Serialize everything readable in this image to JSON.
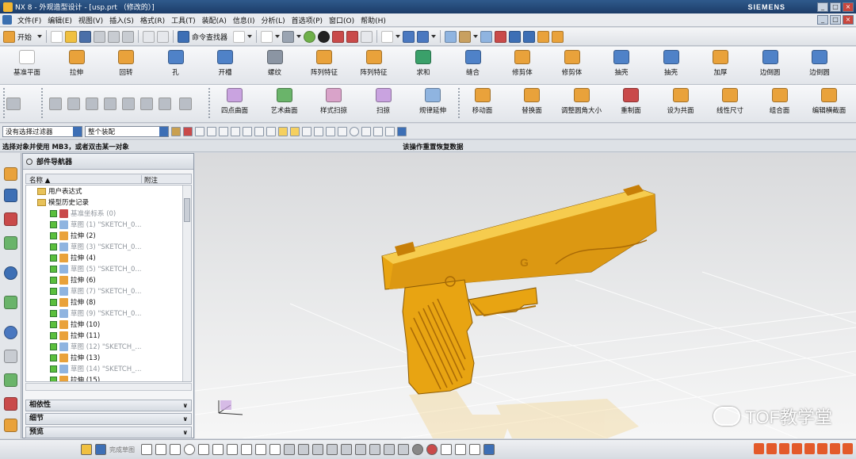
{
  "window": {
    "title": "NX 8 - 外观造型设计 - [usp.prt （修改的）]",
    "brand": "SIEMENS",
    "min": "_",
    "max": "□",
    "close": "×"
  },
  "menu": [
    "文件(F)",
    "编辑(E)",
    "视图(V)",
    "插入(S)",
    "格式(R)",
    "工具(T)",
    "装配(A)",
    "信息(I)",
    "分析(L)",
    "首选项(P)",
    "窗口(O)",
    "帮助(H)"
  ],
  "std_toolbar": {
    "start_label": "开始",
    "command_finder_label": "命令查找器"
  },
  "feature_toolbar_1": [
    {
      "label": "基准平面",
      "icon": "datum-plane-icon",
      "color": "#ffffff"
    },
    {
      "label": "拉伸",
      "icon": "extrude-icon",
      "color": "#e9a23b"
    },
    {
      "label": "回转",
      "icon": "revolve-icon",
      "color": "#e9a23b"
    },
    {
      "label": "孔",
      "icon": "hole-icon",
      "color": "#4f82c8"
    },
    {
      "label": "开槽",
      "icon": "groove-icon",
      "color": "#4f82c8"
    },
    {
      "label": "螺纹",
      "icon": "thread-icon",
      "color": "#8b95a3"
    },
    {
      "label": "阵列特征",
      "icon": "pattern-feature-icon",
      "color": "#e9a23b"
    },
    {
      "label": "阵列特征",
      "icon": "pattern-feature-icon",
      "color": "#e9a23b"
    },
    {
      "label": "求和",
      "icon": "unite-icon",
      "color": "#3aa06a"
    },
    {
      "label": "缝合",
      "icon": "sew-icon",
      "color": "#4f82c8"
    },
    {
      "label": "修剪体",
      "icon": "trim-body-icon",
      "color": "#e9a23b"
    },
    {
      "label": "修剪体",
      "icon": "trim-body-icon",
      "color": "#e9a23b"
    },
    {
      "label": "抽壳",
      "icon": "shell-icon",
      "color": "#4f82c8"
    },
    {
      "label": "抽壳",
      "icon": "shell-icon",
      "color": "#4f82c8"
    },
    {
      "label": "加厚",
      "icon": "thicken-icon",
      "color": "#e9a23b"
    },
    {
      "label": "边倒圆",
      "icon": "edge-blend-icon",
      "color": "#4f82c8"
    },
    {
      "label": "边倒圆",
      "icon": "edge-blend-icon",
      "color": "#4f82c8"
    }
  ],
  "feature_toolbar_2": [
    {
      "label": "四点曲面",
      "icon": "four-point-surface-icon",
      "color": "#c9a3e0"
    },
    {
      "label": "艺术曲面",
      "icon": "studio-surface-icon",
      "color": "#6ab46a"
    },
    {
      "label": "样式扫掠",
      "icon": "styled-sweep-icon",
      "color": "#d9a3c9"
    },
    {
      "label": "扫掠",
      "icon": "swept-icon",
      "color": "#c9a3e0"
    },
    {
      "label": "规律延伸",
      "icon": "law-extension-icon",
      "color": "#8fb4e0"
    },
    {
      "label": "移动面",
      "icon": "move-face-icon",
      "color": "#e9a23b"
    },
    {
      "label": "替换面",
      "icon": "replace-face-icon",
      "color": "#e9a23b"
    },
    {
      "label": "调整圆角大小",
      "icon": "resize-blend-icon",
      "color": "#e9a23b"
    },
    {
      "label": "重制面",
      "icon": "remake-face-icon",
      "color": "#c94a4a"
    },
    {
      "label": "设为共面",
      "icon": "make-coplanar-icon",
      "color": "#e9a23b"
    },
    {
      "label": "线性尺寸",
      "icon": "linear-dimension-icon",
      "color": "#e9a23b"
    },
    {
      "label": "组合面",
      "icon": "group-face-icon",
      "color": "#e9a23b"
    },
    {
      "label": "编辑横截面",
      "icon": "edit-section-icon",
      "color": "#e9a23b"
    }
  ],
  "selection_bar": {
    "filter": "没有选择过滤器",
    "scope": "整个装配"
  },
  "cue_line": "选择对象并使用 MB3，或者双击某一对象",
  "status_line": "该操作重置恢复数据",
  "part_navigator": {
    "title": "部件导航器",
    "col_name": "名称",
    "col_sort": "▲",
    "col_comment": "附注",
    "tree": [
      {
        "label": "用户表达式",
        "kind": "folder",
        "dim": false
      },
      {
        "label": "模型历史记录",
        "kind": "folder",
        "dim": false
      },
      {
        "label": "基准坐标系 (0)",
        "kind": "datum",
        "dim": true
      },
      {
        "label": "草图 (1) \"SKETCH_0...",
        "kind": "sketch",
        "dim": true
      },
      {
        "label": "拉伸 (2)",
        "kind": "extrude",
        "dim": false
      },
      {
        "label": "草图 (3) \"SKETCH_0...",
        "kind": "sketch",
        "dim": true
      },
      {
        "label": "拉伸 (4)",
        "kind": "extrude",
        "dim": false
      },
      {
        "label": "草图 (5) \"SKETCH_0...",
        "kind": "sketch",
        "dim": true
      },
      {
        "label": "拉伸 (6)",
        "kind": "extrude",
        "dim": false
      },
      {
        "label": "草图 (7) \"SKETCH_0...",
        "kind": "sketch",
        "dim": true
      },
      {
        "label": "拉伸 (8)",
        "kind": "extrude",
        "dim": false
      },
      {
        "label": "草图 (9) \"SKETCH_0...",
        "kind": "sketch",
        "dim": true
      },
      {
        "label": "拉伸 (10)",
        "kind": "extrude",
        "dim": false
      },
      {
        "label": "拉伸 (11)",
        "kind": "extrude",
        "dim": false
      },
      {
        "label": "草图 (12) \"SKETCH_...",
        "kind": "sketch",
        "dim": true
      },
      {
        "label": "拉伸 (13)",
        "kind": "extrude",
        "dim": false
      },
      {
        "label": "草图 (14) \"SKETCH_...",
        "kind": "sketch",
        "dim": true
      },
      {
        "label": "拉伸 (15)",
        "kind": "extrude",
        "dim": false
      }
    ],
    "panels": [
      "相依性",
      "细节",
      "预览"
    ]
  },
  "bottom_toolbar": {
    "sketch_label": "完成草图"
  },
  "watermark": "TOF教学堂",
  "colors": {
    "model_gold": "#e8a412",
    "title_bar": "#2f5a8c",
    "accent_blue": "#3d6fb5"
  }
}
